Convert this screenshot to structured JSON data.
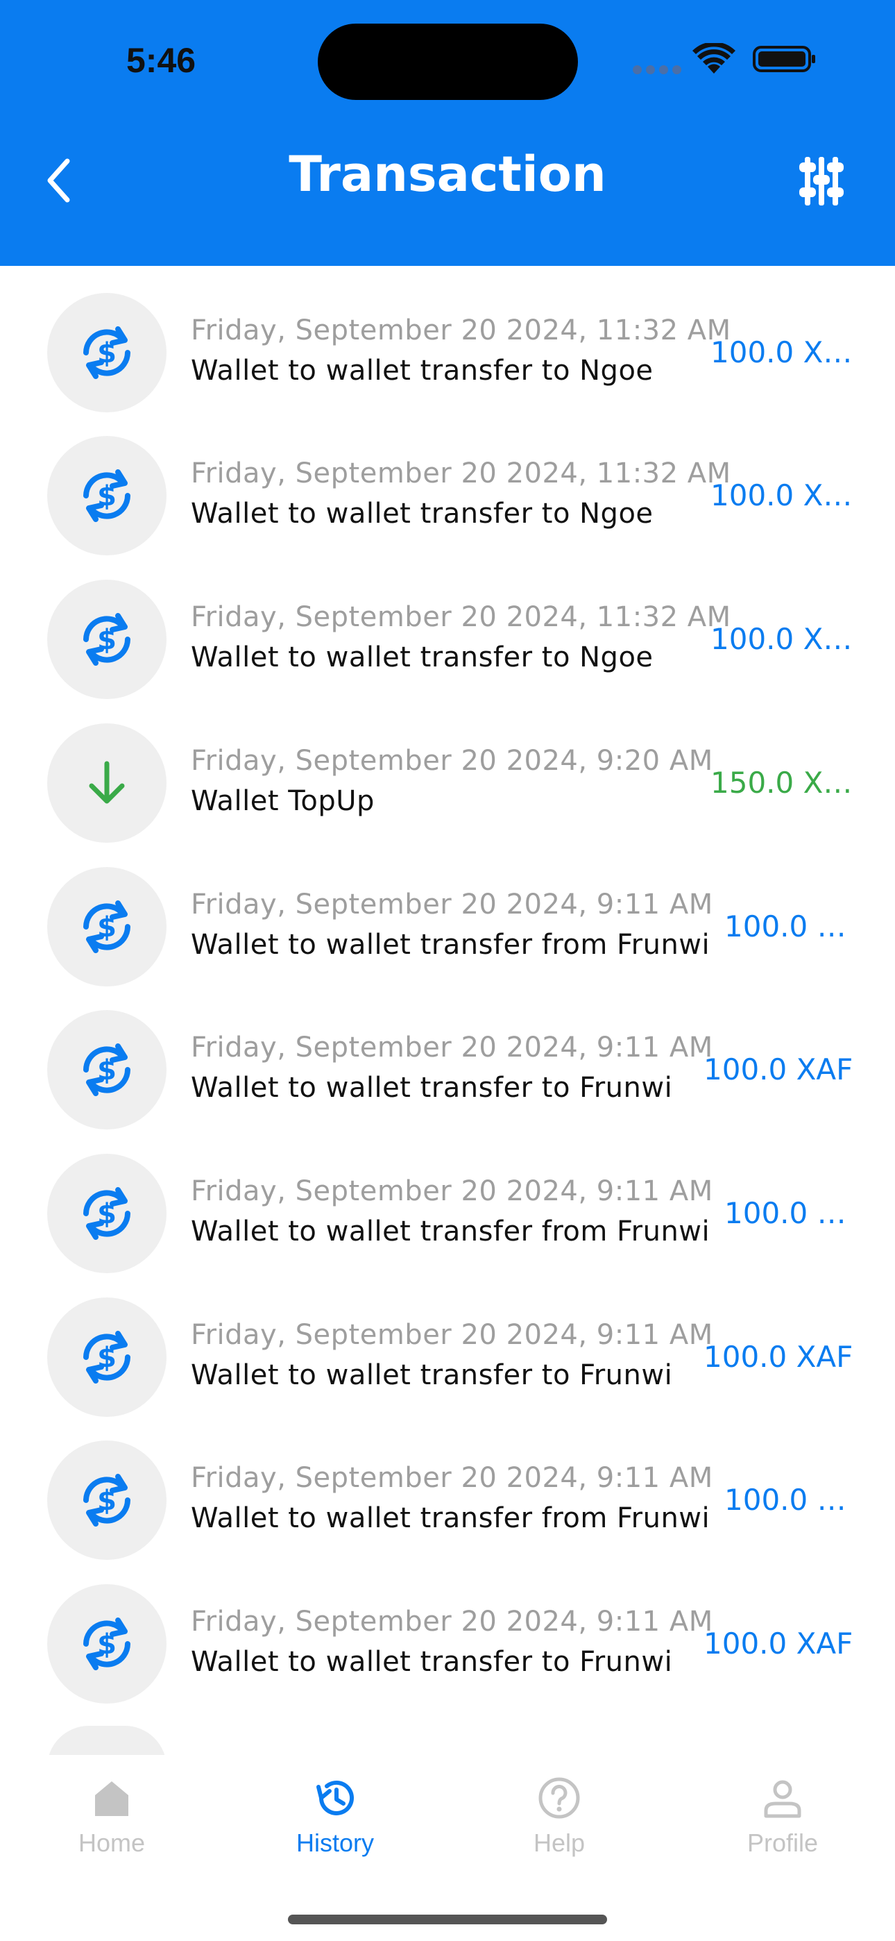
{
  "status_bar": {
    "time": "5:46"
  },
  "header": {
    "title": "Transaction",
    "back_icon": "chevron-left-icon",
    "filter_icon": "filter-sliders-icon"
  },
  "colors": {
    "primary": "#0a7cf0",
    "credit": "#3aaa48",
    "muted": "#9e9e9e"
  },
  "transactions": [
    {
      "date": "Friday, September 20 2024, 11:32 AM",
      "description": "Wallet to wallet transfer to Ngoe",
      "amount": "100.0 X…",
      "icon": "currency-exchange-icon",
      "type": "transfer"
    },
    {
      "date": "Friday, September 20 2024, 11:32 AM",
      "description": "Wallet to wallet transfer to Ngoe",
      "amount": "100.0 X…",
      "icon": "currency-exchange-icon",
      "type": "transfer"
    },
    {
      "date": "Friday, September 20 2024, 11:32 AM",
      "description": "Wallet to wallet transfer to Ngoe",
      "amount": "100.0 X…",
      "icon": "currency-exchange-icon",
      "type": "transfer"
    },
    {
      "date": "Friday, September 20 2024, 9:20 AM",
      "description": "Wallet TopUp",
      "amount": "150.0 X…",
      "icon": "arrow-down-icon",
      "type": "topup"
    },
    {
      "date": "Friday, September 20 2024, 9:11 AM",
      "description": "Wallet to wallet transfer from Frunwi",
      "amount": "100.0 …",
      "icon": "currency-exchange-icon",
      "type": "transfer"
    },
    {
      "date": "Friday, September 20 2024, 9:11 AM",
      "description": "Wallet to wallet transfer to Frunwi",
      "amount": "100.0 XAF",
      "icon": "currency-exchange-icon",
      "type": "transfer"
    },
    {
      "date": "Friday, September 20 2024, 9:11 AM",
      "description": "Wallet to wallet transfer from Frunwi",
      "amount": "100.0 …",
      "icon": "currency-exchange-icon",
      "type": "transfer"
    },
    {
      "date": "Friday, September 20 2024, 9:11 AM",
      "description": "Wallet to wallet transfer to Frunwi",
      "amount": "100.0 XAF",
      "icon": "currency-exchange-icon",
      "type": "transfer"
    },
    {
      "date": "Friday, September 20 2024, 9:11 AM",
      "description": "Wallet to wallet transfer from Frunwi",
      "amount": "100.0 …",
      "icon": "currency-exchange-icon",
      "type": "transfer"
    },
    {
      "date": "Friday, September 20 2024, 9:11 AM",
      "description": "Wallet to wallet transfer to Frunwi",
      "amount": "100.0 XAF",
      "icon": "currency-exchange-icon",
      "type": "transfer"
    }
  ],
  "bottom_nav": {
    "items": [
      {
        "label": "Home",
        "icon": "home-icon"
      },
      {
        "label": "History",
        "icon": "history-icon",
        "active": true
      },
      {
        "label": "Help",
        "icon": "help-circle-icon"
      },
      {
        "label": "Profile",
        "icon": "profile-icon"
      }
    ]
  }
}
